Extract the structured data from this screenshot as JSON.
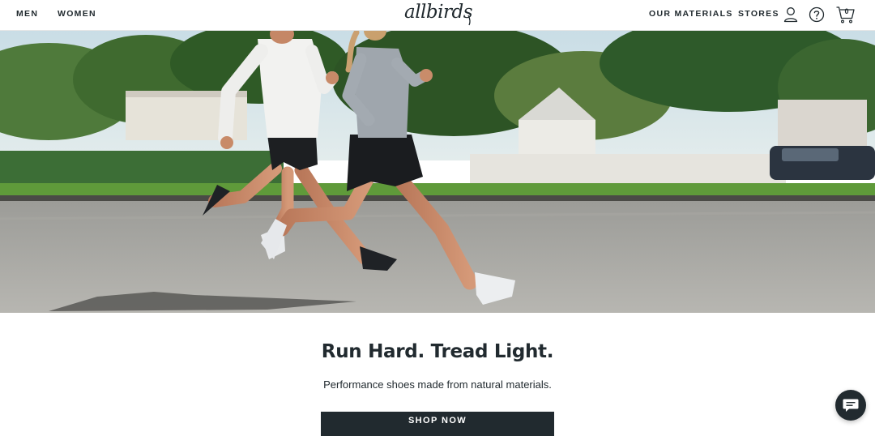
{
  "header": {
    "nav_left": [
      "MEN",
      "WOMEN"
    ],
    "logo": "allbirds",
    "nav_right": [
      "OUR MATERIALS",
      "STORES"
    ],
    "icons": [
      "account-icon",
      "help-icon",
      "cart-icon"
    ],
    "cart_count": "0"
  },
  "hero": {
    "image": "two-runners-on-street"
  },
  "content": {
    "headline": "Run Hard. Tread Light.",
    "subhead": "Performance shoes made from natural materials.",
    "cta_label": "SHOP NOW"
  },
  "chat": {
    "icon": "chat-icon"
  },
  "colors": {
    "text": "#212a2f",
    "button_bg": "#212a2f",
    "button_text": "#ffffff",
    "background": "#ffffff"
  }
}
